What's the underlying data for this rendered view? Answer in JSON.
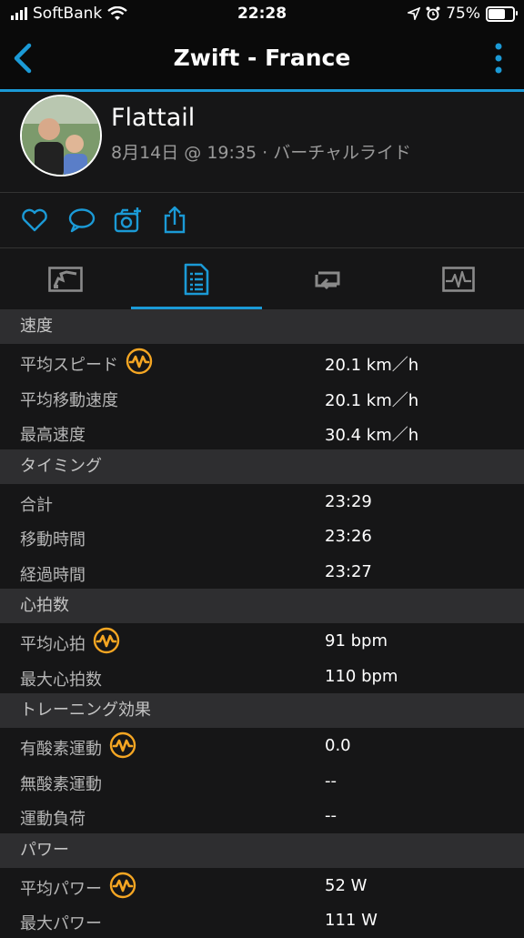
{
  "status_bar": {
    "carrier": "SoftBank",
    "time": "22:28",
    "battery": "75%"
  },
  "nav": {
    "title": "Zwift - France"
  },
  "profile": {
    "name": "Flattail",
    "meta": "8月14日 @ 19:35 · バーチャルライド"
  },
  "accent_color": "#1b9ad6",
  "badge_color": "#f5a623",
  "sections": [
    {
      "header": "速度",
      "rows": [
        {
          "label": "平均スピード",
          "value": "20.1 km／h",
          "badge": true
        },
        {
          "label": "平均移動速度",
          "value": "20.1 km／h",
          "badge": false
        },
        {
          "label": "最高速度",
          "value": "30.4 km／h",
          "badge": false
        }
      ]
    },
    {
      "header": "タイミング",
      "rows": [
        {
          "label": "合計",
          "value": "23:29",
          "badge": false
        },
        {
          "label": "移動時間",
          "value": "23:26",
          "badge": false
        },
        {
          "label": "経過時間",
          "value": "23:27",
          "badge": false
        }
      ]
    },
    {
      "header": "心拍数",
      "rows": [
        {
          "label": "平均心拍",
          "value": "91 bpm",
          "badge": true
        },
        {
          "label": "最大心拍数",
          "value": "110 bpm",
          "badge": false
        }
      ]
    },
    {
      "header": "トレーニング効果",
      "rows": [
        {
          "label": "有酸素運動",
          "value": "0.0",
          "badge": true
        },
        {
          "label": "無酸素運動",
          "value": "--",
          "badge": false
        },
        {
          "label": "運動負荷",
          "value": "--",
          "badge": false
        }
      ]
    },
    {
      "header": "パワー",
      "rows": [
        {
          "label": "平均パワー",
          "value": "52 W",
          "badge": true
        },
        {
          "label": "最大パワー",
          "value": "111 W",
          "badge": false
        }
      ]
    }
  ]
}
